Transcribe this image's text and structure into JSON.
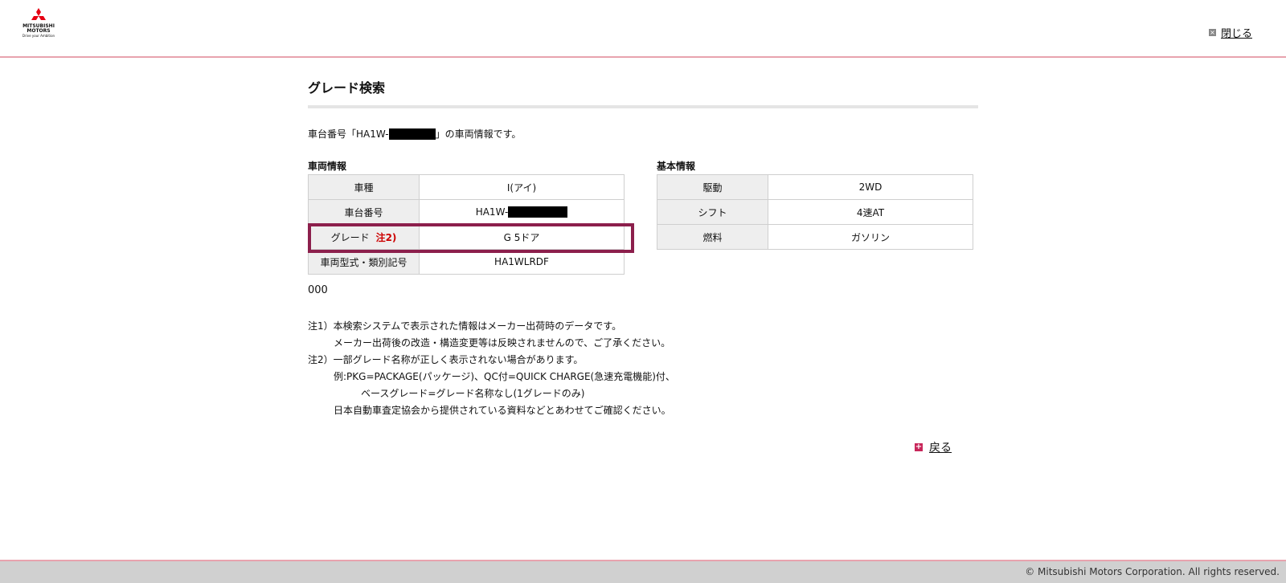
{
  "header": {
    "logo": {
      "line1": "MITSUBISHI",
      "line2": "MOTORS",
      "tagline": "Drive your Ambition"
    },
    "close_label": "閉じる",
    "colors": {
      "brand_red": "#e60012",
      "header_line": "#e8a3ae"
    }
  },
  "page": {
    "title": "グレード検索",
    "intro_prefix": "車台番号「HA1W-",
    "intro_suffix": "」の車両情報です。"
  },
  "vehicle_info": {
    "label": "車両情報",
    "rows": [
      {
        "label": "車種",
        "value": "I(アイ)"
      },
      {
        "label": "車台番号",
        "value": "HA1W-"
      },
      {
        "label": "グレード",
        "note": "注2)",
        "value": "G 5ドア"
      },
      {
        "label": "車両型式・類別記号",
        "value": "HA1WLRDF"
      }
    ],
    "highlight_color": "#8c1f4c"
  },
  "basic_info": {
    "label": "基本情報",
    "rows": [
      {
        "label": "駆動",
        "value": "2WD"
      },
      {
        "label": "シフト",
        "value": "4速AT"
      },
      {
        "label": "燃料",
        "value": "ガソリン"
      }
    ]
  },
  "misc": "000",
  "notes": [
    "注1）本検索システムで表示された情報はメーカー出荷時のデータです。",
    "メーカー出荷後の改造・構造変更等は反映されませんので、ご了承ください。",
    "注2）一部グレード名称が正しく表示されない場合があります。",
    "例:PKG=PACKAGE(パッケージ)、QC付=QUICK CHARGE(急速充電機能)付、",
    "ベースグレード=グレード名称なし(1グレードのみ)",
    "日本自動車査定協会から提供されている資料などとあわせてご確認ください。"
  ],
  "back_label": "戻る",
  "footer": {
    "copyright": "© Mitsubishi Motors Corporation. All rights reserved."
  }
}
